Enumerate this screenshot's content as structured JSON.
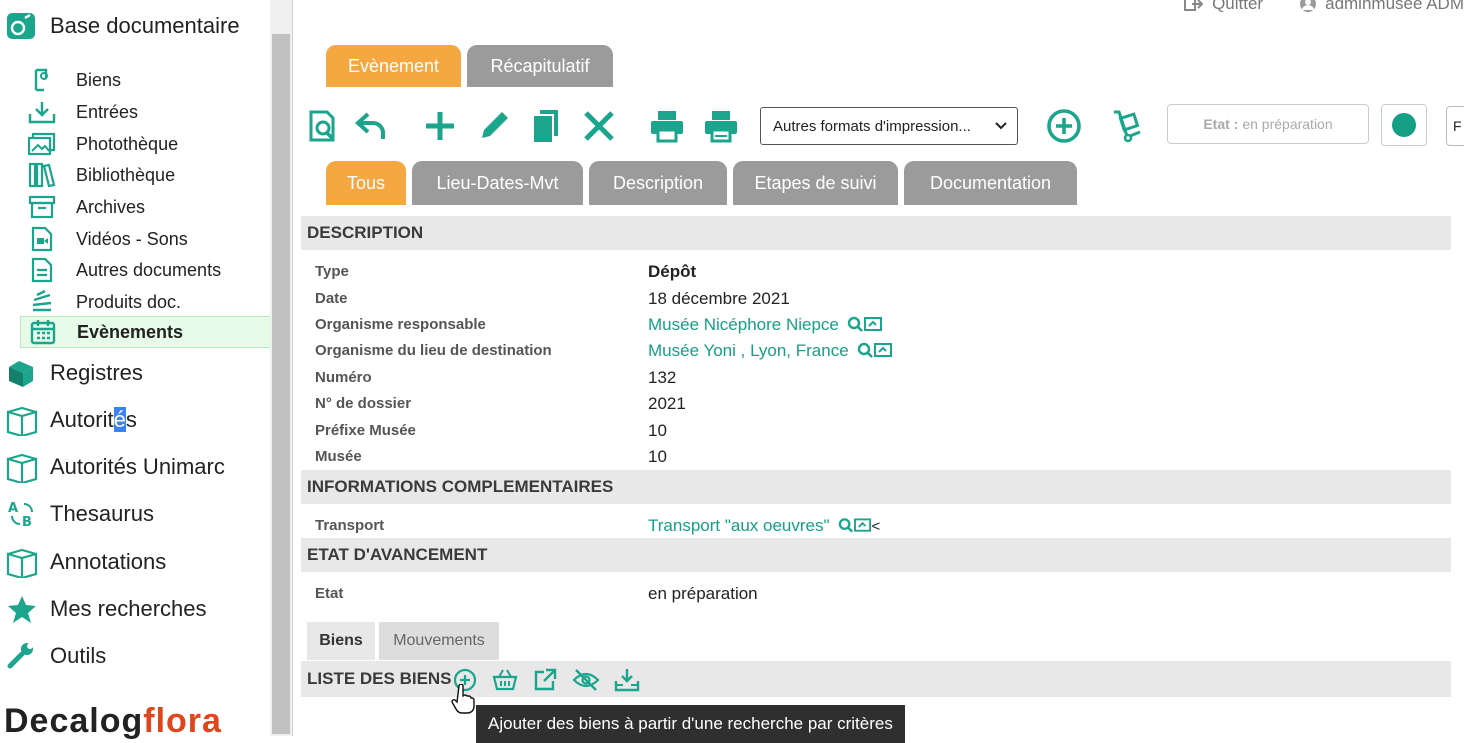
{
  "sidebar": {
    "title": "Base documentaire",
    "sub_items": [
      {
        "label": "Biens",
        "icon": "hand-coin-icon"
      },
      {
        "label": "Entrées",
        "icon": "inbox-download-icon"
      },
      {
        "label": "Photothèque",
        "icon": "images-icon"
      },
      {
        "label": "Bibliothèque",
        "icon": "books-icon"
      },
      {
        "label": "Archives",
        "icon": "archive-box-icon"
      },
      {
        "label": "Vidéos - Sons",
        "icon": "video-file-icon"
      },
      {
        "label": "Autres documents",
        "icon": "document-icon"
      },
      {
        "label": "Produits doc.",
        "icon": "stack-icon"
      },
      {
        "label": "Evènements",
        "icon": "calendar-icon",
        "active": true
      }
    ],
    "top_items": [
      {
        "label": "Registres"
      },
      {
        "label_pre": "Autorit",
        "label_hl": "é",
        "label_post": "s"
      },
      {
        "label": "Autorités Unimarc"
      },
      {
        "label": "Thesaurus"
      },
      {
        "label": "Annotations"
      },
      {
        "label": "Mes recherches"
      },
      {
        "label": "Outils"
      }
    ],
    "logo": {
      "part1": "Decalog",
      "part2": "flora"
    }
  },
  "header": {
    "quit_label": "Quitter",
    "user_label": "adminmusee ADM"
  },
  "main_tabs": [
    {
      "label": "Evènement",
      "active": true
    },
    {
      "label": "Récapitulatif",
      "active": false
    }
  ],
  "toolbar": {
    "print_formats_label": "Autres formats d'impression...",
    "etat_label": "Etat :",
    "etat_value": "en préparation",
    "status_color": "#15a085",
    "edge_box_text": "F"
  },
  "sub_tabs": [
    {
      "label": "Tous",
      "active": true
    },
    {
      "label": "Lieu-Dates-Mvt"
    },
    {
      "label": "Description"
    },
    {
      "label": "Etapes de suivi"
    },
    {
      "label": "Documentation"
    }
  ],
  "sections": {
    "description": "DESCRIPTION",
    "infos": "INFORMATIONS COMPLEMENTAIRES",
    "etat": "ETAT D'AVANCEMENT",
    "liste": "LISTE DES BIENS"
  },
  "fields": {
    "type": {
      "label": "Type",
      "value": "Dépôt"
    },
    "date": {
      "label": "Date",
      "value": "18 décembre 2021"
    },
    "org_resp": {
      "label": "Organisme responsable",
      "value": "Musée Nicéphore Niepce"
    },
    "org_dest": {
      "label": "Organisme du lieu de destination",
      "value": "Musée Yoni , Lyon, France"
    },
    "numero": {
      "label": "Numéro",
      "value": "132"
    },
    "dossier": {
      "label": "N° de dossier",
      "value": "2021"
    },
    "prefixe": {
      "label": "Préfixe Musée",
      "value": "10"
    },
    "musee": {
      "label": "Musée",
      "value": "10"
    },
    "transport": {
      "label": "Transport",
      "value": "Transport \"aux oeuvres\"",
      "suffix": "<"
    },
    "etat": {
      "label": "Etat",
      "value": "en préparation"
    }
  },
  "bottom_tabs": [
    {
      "label": "Biens",
      "active": true
    },
    {
      "label": "Mouvements"
    }
  ],
  "tooltip": "Ajouter des biens à partir d'une recherche par critères",
  "accent_color": "#1aa58c",
  "orange_color": "#f5a742"
}
